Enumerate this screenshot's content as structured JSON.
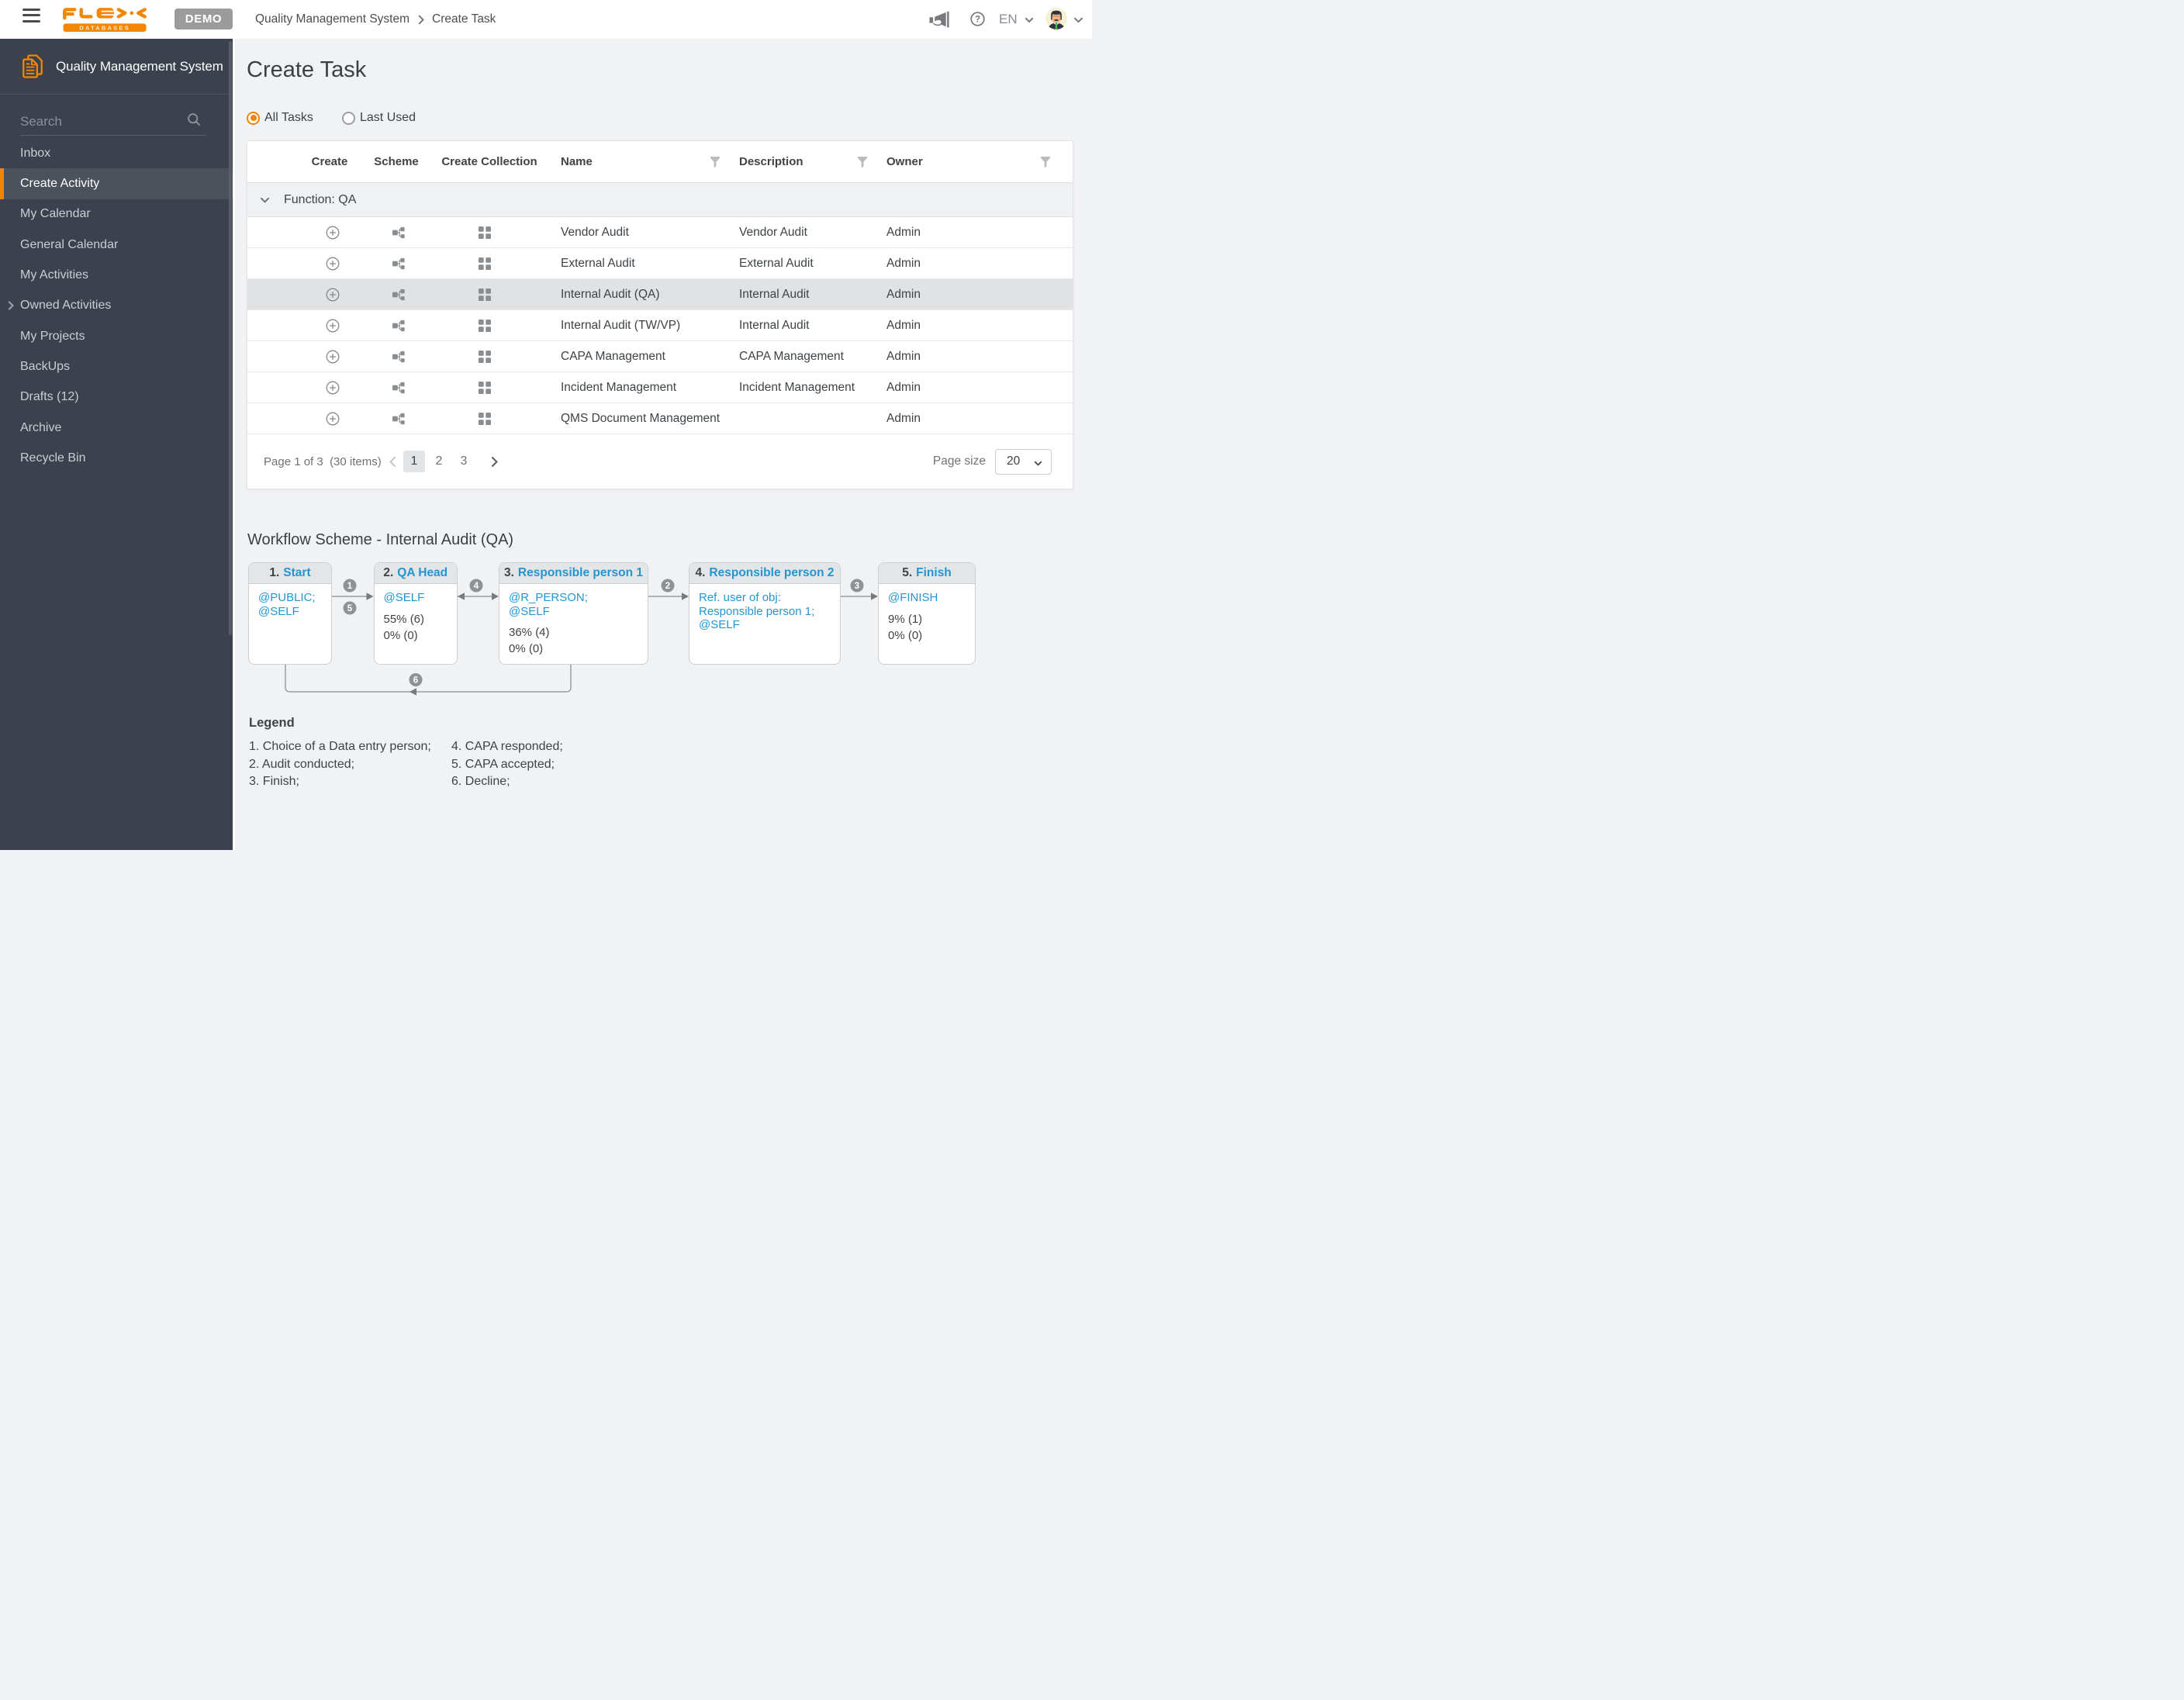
{
  "topbar": {
    "logo": {
      "brand": "FLEX",
      "sub": "DATABASES"
    },
    "demo_label": "DEMO",
    "breadcrumb": {
      "module": "Quality Management System",
      "page": "Create Task"
    },
    "language": "EN"
  },
  "sidebar": {
    "module_title": "Quality Management System",
    "search_placeholder": "Search",
    "items": [
      {
        "label": "Inbox"
      },
      {
        "label": "Create Activity",
        "active": true
      },
      {
        "label": "My Calendar"
      },
      {
        "label": "General Calendar"
      },
      {
        "label": "My Activities"
      },
      {
        "label": "Owned Activities",
        "has_children": true
      },
      {
        "label": "My Projects"
      },
      {
        "label": "BackUps"
      },
      {
        "label": "Drafts (12)"
      },
      {
        "label": "Archive"
      },
      {
        "label": "Recycle Bin"
      }
    ]
  },
  "main": {
    "title": "Create Task",
    "radios": [
      {
        "label": "All Tasks",
        "selected": true
      },
      {
        "label": "Last Used",
        "selected": false
      }
    ],
    "table": {
      "columns": {
        "create": "Create",
        "scheme": "Scheme",
        "collection": "Create Collection",
        "name": "Name",
        "description": "Description",
        "owner": "Owner"
      },
      "group_label": "Function: QA",
      "rows": [
        {
          "name": "Vendor Audit",
          "description": "Vendor Audit",
          "owner": "Admin"
        },
        {
          "name": "External Audit",
          "description": "External Audit",
          "owner": "Admin"
        },
        {
          "name": "Internal Audit (QA)",
          "description": "Internal Audit",
          "owner": "Admin",
          "highlighted": true
        },
        {
          "name": "Internal Audit (TW/VP)",
          "description": "Internal Audit",
          "owner": "Admin"
        },
        {
          "name": "CAPA Management",
          "description": "CAPA Management",
          "owner": "Admin"
        },
        {
          "name": "Incident Management",
          "description": "Incident Management",
          "owner": "Admin"
        },
        {
          "name": "QMS Document Management",
          "description": "",
          "owner": "Admin"
        }
      ]
    },
    "pagination": {
      "summary": "Page 1 of 3  (30 items)",
      "pages": [
        {
          "n": "1",
          "current": true
        },
        {
          "n": "2"
        },
        {
          "n": "3"
        }
      ],
      "page_size_label": "Page size",
      "page_size": "20"
    }
  },
  "workflow": {
    "title": "Workflow Scheme - Internal Audit (QA)",
    "nodes": [
      {
        "num": "1.",
        "name": "Start",
        "acl": [
          "@PUBLIC;",
          "@SELF"
        ],
        "stats": []
      },
      {
        "num": "2.",
        "name": "QA Head",
        "acl": [
          "@SELF"
        ],
        "stats": [
          "55% (6)",
          "0% (0)"
        ]
      },
      {
        "num": "3.",
        "name": "Responsible person 1",
        "acl": [
          "@R_PERSON;",
          "@SELF"
        ],
        "stats": [
          "36% (4)",
          "0% (0)"
        ]
      },
      {
        "num": "4.",
        "name": "Responsible person 2",
        "acl": [
          "Ref. user of obj:",
          "Responsible person 1;",
          "@SELF"
        ],
        "stats": []
      },
      {
        "num": "5.",
        "name": "Finish",
        "acl": [
          "@FINISH"
        ],
        "stats": [
          "9% (1)",
          "0% (0)"
        ]
      }
    ],
    "connectors": {
      "c1": "1",
      "c2": "2",
      "c3": "3",
      "c4": "4",
      "c5": "5",
      "c6": "6"
    }
  },
  "legend": {
    "title": "Legend",
    "col1": [
      "1. Choice of a Data entry person;",
      "2. Audit conducted;",
      "3. Finish;"
    ],
    "col2": [
      "4. CAPA responded;",
      "5. CAPA accepted;",
      "6. Decline;"
    ]
  },
  "colors": {
    "accent_orange": "#ef8505",
    "sidebar_bg": "#3b424d",
    "sidebar_active_bg": "#4b525c",
    "workflow_blue": "#2396d2",
    "main_bg": "#f1f2f4",
    "row_highlight": "#e1e2e3",
    "text_primary": "#3f4346",
    "text_secondary": "#6f7275",
    "icon_gray": "#8a8d90"
  },
  "icons": {
    "hamburger": "menu",
    "megaphone": "announcements",
    "help": "question-circle",
    "language_caret": "chevron-down",
    "user_caret": "chevron-down",
    "module": "documents",
    "search": "magnifier",
    "expand": "chevron-right",
    "breadcrumb_sep": "chevron-right",
    "create": "plus-circle",
    "scheme": "org-nodes",
    "create_collection": "grid-squares",
    "filter": "funnel",
    "group_collapse": "chevron-down",
    "pager_prev": "chevron-left",
    "pager_next": "chevron-right",
    "page_size_caret": "caret-down"
  }
}
